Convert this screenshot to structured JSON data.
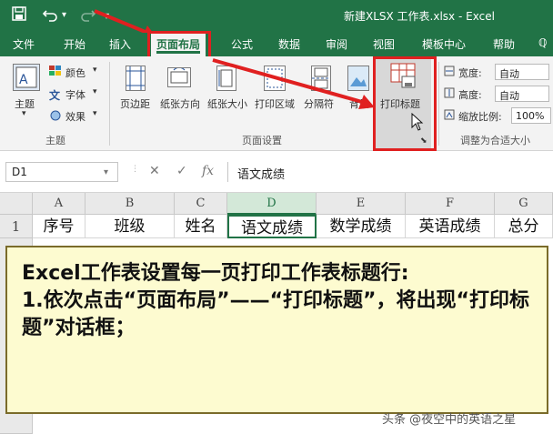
{
  "window": {
    "title": "新建XLSX 工作表.xlsx  -  Excel",
    "qat": [
      "save-icon",
      "undo-icon",
      "redo-icon",
      "customize-icon"
    ]
  },
  "tabs": [
    "文件",
    "开始",
    "插入",
    "页面布局",
    "公式",
    "数据",
    "审阅",
    "视图",
    "模板中心",
    "帮助",
    "ℚ"
  ],
  "active_tab": "页面布局",
  "ribbon": {
    "theme_group": {
      "label": "主题",
      "themes": "主题",
      "colors": "颜色",
      "fonts": "字体",
      "effects": "效果"
    },
    "page_setup_group": {
      "label": "页面设置",
      "margins": "页边距",
      "orientation": "纸张方向",
      "size": "纸张大小",
      "print_area": "打印区域",
      "breaks": "分隔符",
      "background": "背景",
      "print_titles": "打印标题"
    },
    "scale_group": {
      "label": "调整为合适大小",
      "width_label": "宽度:",
      "width_value": "自动",
      "height_label": "高度:",
      "height_value": "自动",
      "scale_label": "缩放比例:",
      "scale_value": "100%"
    }
  },
  "formula_bar": {
    "name_box": "D1",
    "content": "语文成绩"
  },
  "columns": [
    "A",
    "B",
    "C",
    "D",
    "E",
    "F",
    "G"
  ],
  "selected_column": "D",
  "rows": [
    {
      "num": "1",
      "cells": [
        "序号",
        "班级",
        "姓名",
        "语文成绩",
        "数学成绩",
        "英语成绩",
        "总分"
      ]
    }
  ],
  "callout": {
    "line1": "Excel工作表设置每一页打印工作表标题行:",
    "line2": "1.依次点击“页面布局”——“打印标题”，将出现“打印标题”对话框；"
  },
  "watermark": "头条 @夜空中的英语之星",
  "colors": {
    "accent": "#217346",
    "highlight": "#e02020",
    "callout_bg": "#fdfbd0"
  }
}
